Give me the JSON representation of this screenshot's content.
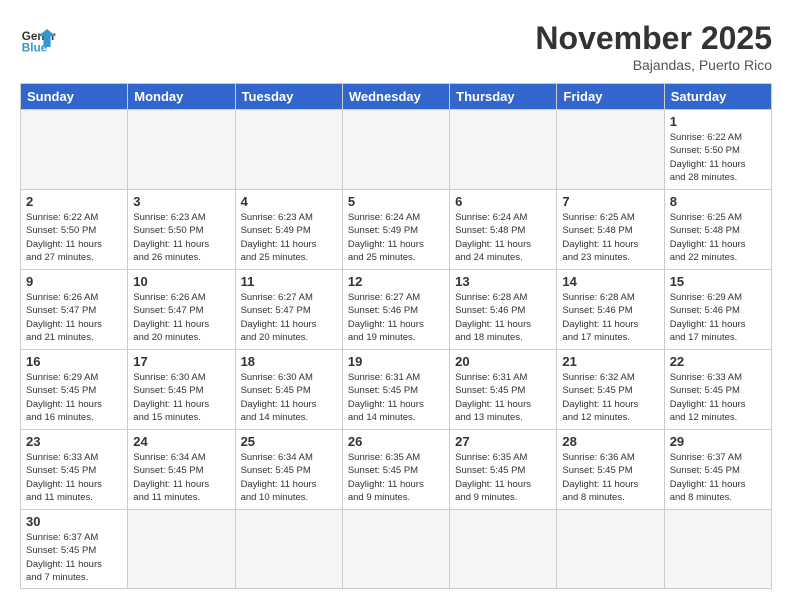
{
  "header": {
    "logo_general": "General",
    "logo_blue": "Blue",
    "month_title": "November 2025",
    "location": "Bajandas, Puerto Rico"
  },
  "days_of_week": [
    "Sunday",
    "Monday",
    "Tuesday",
    "Wednesday",
    "Thursday",
    "Friday",
    "Saturday"
  ],
  "weeks": [
    [
      {
        "day": "",
        "info": ""
      },
      {
        "day": "",
        "info": ""
      },
      {
        "day": "",
        "info": ""
      },
      {
        "day": "",
        "info": ""
      },
      {
        "day": "",
        "info": ""
      },
      {
        "day": "",
        "info": ""
      },
      {
        "day": "1",
        "info": "Sunrise: 6:22 AM\nSunset: 5:50 PM\nDaylight: 11 hours\nand 28 minutes."
      }
    ],
    [
      {
        "day": "2",
        "info": "Sunrise: 6:22 AM\nSunset: 5:50 PM\nDaylight: 11 hours\nand 27 minutes."
      },
      {
        "day": "3",
        "info": "Sunrise: 6:23 AM\nSunset: 5:50 PM\nDaylight: 11 hours\nand 26 minutes."
      },
      {
        "day": "4",
        "info": "Sunrise: 6:23 AM\nSunset: 5:49 PM\nDaylight: 11 hours\nand 25 minutes."
      },
      {
        "day": "5",
        "info": "Sunrise: 6:24 AM\nSunset: 5:49 PM\nDaylight: 11 hours\nand 25 minutes."
      },
      {
        "day": "6",
        "info": "Sunrise: 6:24 AM\nSunset: 5:48 PM\nDaylight: 11 hours\nand 24 minutes."
      },
      {
        "day": "7",
        "info": "Sunrise: 6:25 AM\nSunset: 5:48 PM\nDaylight: 11 hours\nand 23 minutes."
      },
      {
        "day": "8",
        "info": "Sunrise: 6:25 AM\nSunset: 5:48 PM\nDaylight: 11 hours\nand 22 minutes."
      }
    ],
    [
      {
        "day": "9",
        "info": "Sunrise: 6:26 AM\nSunset: 5:47 PM\nDaylight: 11 hours\nand 21 minutes."
      },
      {
        "day": "10",
        "info": "Sunrise: 6:26 AM\nSunset: 5:47 PM\nDaylight: 11 hours\nand 20 minutes."
      },
      {
        "day": "11",
        "info": "Sunrise: 6:27 AM\nSunset: 5:47 PM\nDaylight: 11 hours\nand 20 minutes."
      },
      {
        "day": "12",
        "info": "Sunrise: 6:27 AM\nSunset: 5:46 PM\nDaylight: 11 hours\nand 19 minutes."
      },
      {
        "day": "13",
        "info": "Sunrise: 6:28 AM\nSunset: 5:46 PM\nDaylight: 11 hours\nand 18 minutes."
      },
      {
        "day": "14",
        "info": "Sunrise: 6:28 AM\nSunset: 5:46 PM\nDaylight: 11 hours\nand 17 minutes."
      },
      {
        "day": "15",
        "info": "Sunrise: 6:29 AM\nSunset: 5:46 PM\nDaylight: 11 hours\nand 17 minutes."
      }
    ],
    [
      {
        "day": "16",
        "info": "Sunrise: 6:29 AM\nSunset: 5:45 PM\nDaylight: 11 hours\nand 16 minutes."
      },
      {
        "day": "17",
        "info": "Sunrise: 6:30 AM\nSunset: 5:45 PM\nDaylight: 11 hours\nand 15 minutes."
      },
      {
        "day": "18",
        "info": "Sunrise: 6:30 AM\nSunset: 5:45 PM\nDaylight: 11 hours\nand 14 minutes."
      },
      {
        "day": "19",
        "info": "Sunrise: 6:31 AM\nSunset: 5:45 PM\nDaylight: 11 hours\nand 14 minutes."
      },
      {
        "day": "20",
        "info": "Sunrise: 6:31 AM\nSunset: 5:45 PM\nDaylight: 11 hours\nand 13 minutes."
      },
      {
        "day": "21",
        "info": "Sunrise: 6:32 AM\nSunset: 5:45 PM\nDaylight: 11 hours\nand 12 minutes."
      },
      {
        "day": "22",
        "info": "Sunrise: 6:33 AM\nSunset: 5:45 PM\nDaylight: 11 hours\nand 12 minutes."
      }
    ],
    [
      {
        "day": "23",
        "info": "Sunrise: 6:33 AM\nSunset: 5:45 PM\nDaylight: 11 hours\nand 11 minutes."
      },
      {
        "day": "24",
        "info": "Sunrise: 6:34 AM\nSunset: 5:45 PM\nDaylight: 11 hours\nand 11 minutes."
      },
      {
        "day": "25",
        "info": "Sunrise: 6:34 AM\nSunset: 5:45 PM\nDaylight: 11 hours\nand 10 minutes."
      },
      {
        "day": "26",
        "info": "Sunrise: 6:35 AM\nSunset: 5:45 PM\nDaylight: 11 hours\nand 9 minutes."
      },
      {
        "day": "27",
        "info": "Sunrise: 6:35 AM\nSunset: 5:45 PM\nDaylight: 11 hours\nand 9 minutes."
      },
      {
        "day": "28",
        "info": "Sunrise: 6:36 AM\nSunset: 5:45 PM\nDaylight: 11 hours\nand 8 minutes."
      },
      {
        "day": "29",
        "info": "Sunrise: 6:37 AM\nSunset: 5:45 PM\nDaylight: 11 hours\nand 8 minutes."
      }
    ],
    [
      {
        "day": "30",
        "info": "Sunrise: 6:37 AM\nSunset: 5:45 PM\nDaylight: 11 hours\nand 7 minutes."
      },
      {
        "day": "",
        "info": ""
      },
      {
        "day": "",
        "info": ""
      },
      {
        "day": "",
        "info": ""
      },
      {
        "day": "",
        "info": ""
      },
      {
        "day": "",
        "info": ""
      },
      {
        "day": "",
        "info": ""
      }
    ]
  ]
}
